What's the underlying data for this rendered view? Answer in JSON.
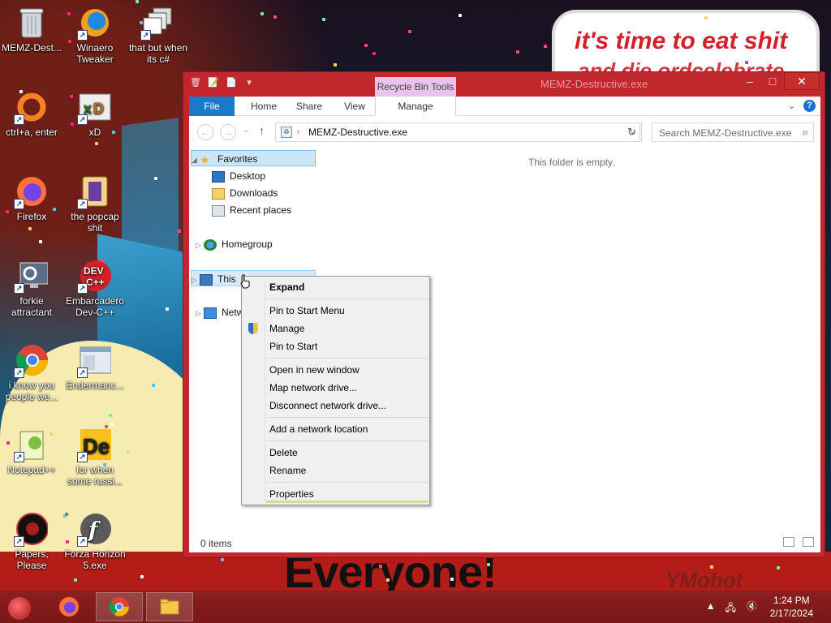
{
  "wallpaper": {
    "speech_text": "it's time to eat shit",
    "speech_text_line2": "and die ordcelebrate",
    "banner_text": "Everyone!",
    "corner_text": "YMobot"
  },
  "desktop_icons": [
    {
      "label": "MEMZ-Dest...",
      "icon": "recycle-bin-icon"
    },
    {
      "label": "Winaero Tweaker",
      "icon": "winaero-icon"
    },
    {
      "label": "that but when its c#",
      "icon": "stacked-windows-icon"
    },
    {
      "label": "ctrl+a, enter",
      "icon": "ring-icon"
    },
    {
      "label": "xD",
      "icon": "hxd-icon"
    },
    {
      "label": "Firefox",
      "icon": "firefox-icon"
    },
    {
      "label": "the popcap shit",
      "icon": "popcap-icon"
    },
    {
      "label": "forkie attractant",
      "icon": "monitor-gear-icon"
    },
    {
      "label": "Embarcadero Dev-C++",
      "icon": "devcpp-icon"
    },
    {
      "label": "i know you people we...",
      "icon": "chrome-icon"
    },
    {
      "label": "Endermanc...",
      "icon": "window-app-icon"
    },
    {
      "label": "Notepad++",
      "icon": "notepadpp-icon"
    },
    {
      "label": "for when some russi...",
      "icon": "de-icon"
    },
    {
      "label": "Papers, Please",
      "icon": "papers-please-icon"
    },
    {
      "label": "Forza Horizon 5.exe",
      "icon": "flash-icon"
    }
  ],
  "explorer": {
    "title": "MEMZ-Destructive.exe",
    "context_tab": "Recycle Bin Tools",
    "ribbon_tabs": [
      "File",
      "Home",
      "Share",
      "View",
      "Manage"
    ],
    "address": "MEMZ-Destructive.exe",
    "search_placeholder": "Search MEMZ-Destructive.exe",
    "empty_message": "This folder is empty.",
    "status": "0 items",
    "tree": {
      "favorites": "Favorites",
      "desktop": "Desktop",
      "downloads": "Downloads",
      "recent": "Recent places",
      "homegroup": "Homegroup",
      "thispc": "This",
      "network": "Netw"
    }
  },
  "context_menu": {
    "expand": "Expand",
    "pin_start_menu": "Pin to Start Menu",
    "manage": "Manage",
    "pin_start": "Pin to Start",
    "open_new_window": "Open in new window",
    "map_drive": "Map network drive...",
    "disconnect_drive": "Disconnect network drive...",
    "add_location": "Add a network location",
    "delete": "Delete",
    "rename": "Rename",
    "properties": "Properties"
  },
  "taskbar": {
    "time": "1:24 PM",
    "date": "2/17/2024",
    "tray_arrow": "▲"
  },
  "colors": {
    "window_frame": "#c1272d",
    "accent_file_tab": "#1979ca",
    "context_tab": "#e9c3eb",
    "taskbar": "#8c1f1f"
  }
}
